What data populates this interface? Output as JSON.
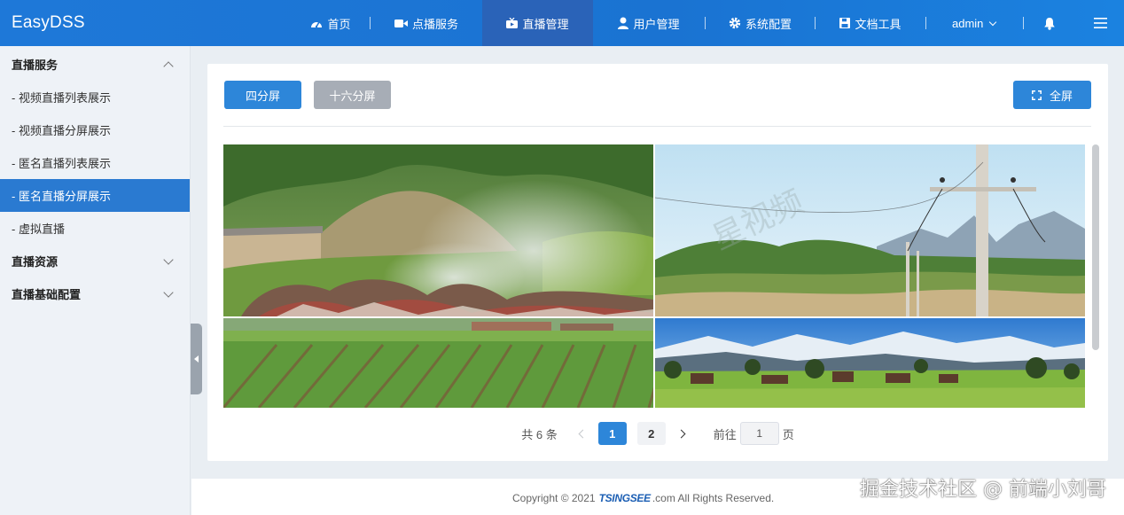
{
  "app": {
    "brand": "EasyDSS"
  },
  "nav": {
    "items": [
      {
        "label": "首页",
        "icon": "dashboard-icon"
      },
      {
        "label": "点播服务",
        "icon": "video-camera-icon"
      },
      {
        "label": "直播管理",
        "icon": "live-tv-icon",
        "active": true
      },
      {
        "label": "用户管理",
        "icon": "user-icon"
      },
      {
        "label": "系统配置",
        "icon": "gear-icon"
      },
      {
        "label": "文档工具",
        "icon": "save-icon"
      }
    ],
    "user": "admin"
  },
  "sidebar": {
    "groups": [
      {
        "label": "直播服务",
        "expanded": true,
        "items": [
          {
            "label": "- 视频直播列表展示"
          },
          {
            "label": "- 视频直播分屏展示"
          },
          {
            "label": "- 匿名直播列表展示"
          },
          {
            "label": "- 匿名直播分屏展示",
            "active": true
          },
          {
            "label": "- 虚拟直播"
          }
        ]
      },
      {
        "label": "直播资源",
        "expanded": false
      },
      {
        "label": "直播基础配置",
        "expanded": false
      }
    ]
  },
  "toolbar": {
    "four_split": "四分屏",
    "sixteen_split": "十六分屏",
    "fullscreen": "全屏"
  },
  "pager": {
    "total": "共 6 条",
    "pages": [
      "1",
      "2"
    ],
    "current": "1",
    "goto_prefix": "前往",
    "goto_value": "1",
    "goto_suffix": "页"
  },
  "footer": {
    "copyright_prefix": "Copyright © 2021",
    "brand": "TSINGSEE",
    "copyright_suffix": ".com All Rights Reserved."
  },
  "overlay_watermark": "掘金技术社区 @ 前端小刘哥",
  "colors": {
    "topbar": "#1e78d8",
    "nav_active": "#2a63b8",
    "primary_button": "#2d86d9",
    "secondary_button": "#a7adb6",
    "sidebar_active": "#2a7ad1"
  }
}
